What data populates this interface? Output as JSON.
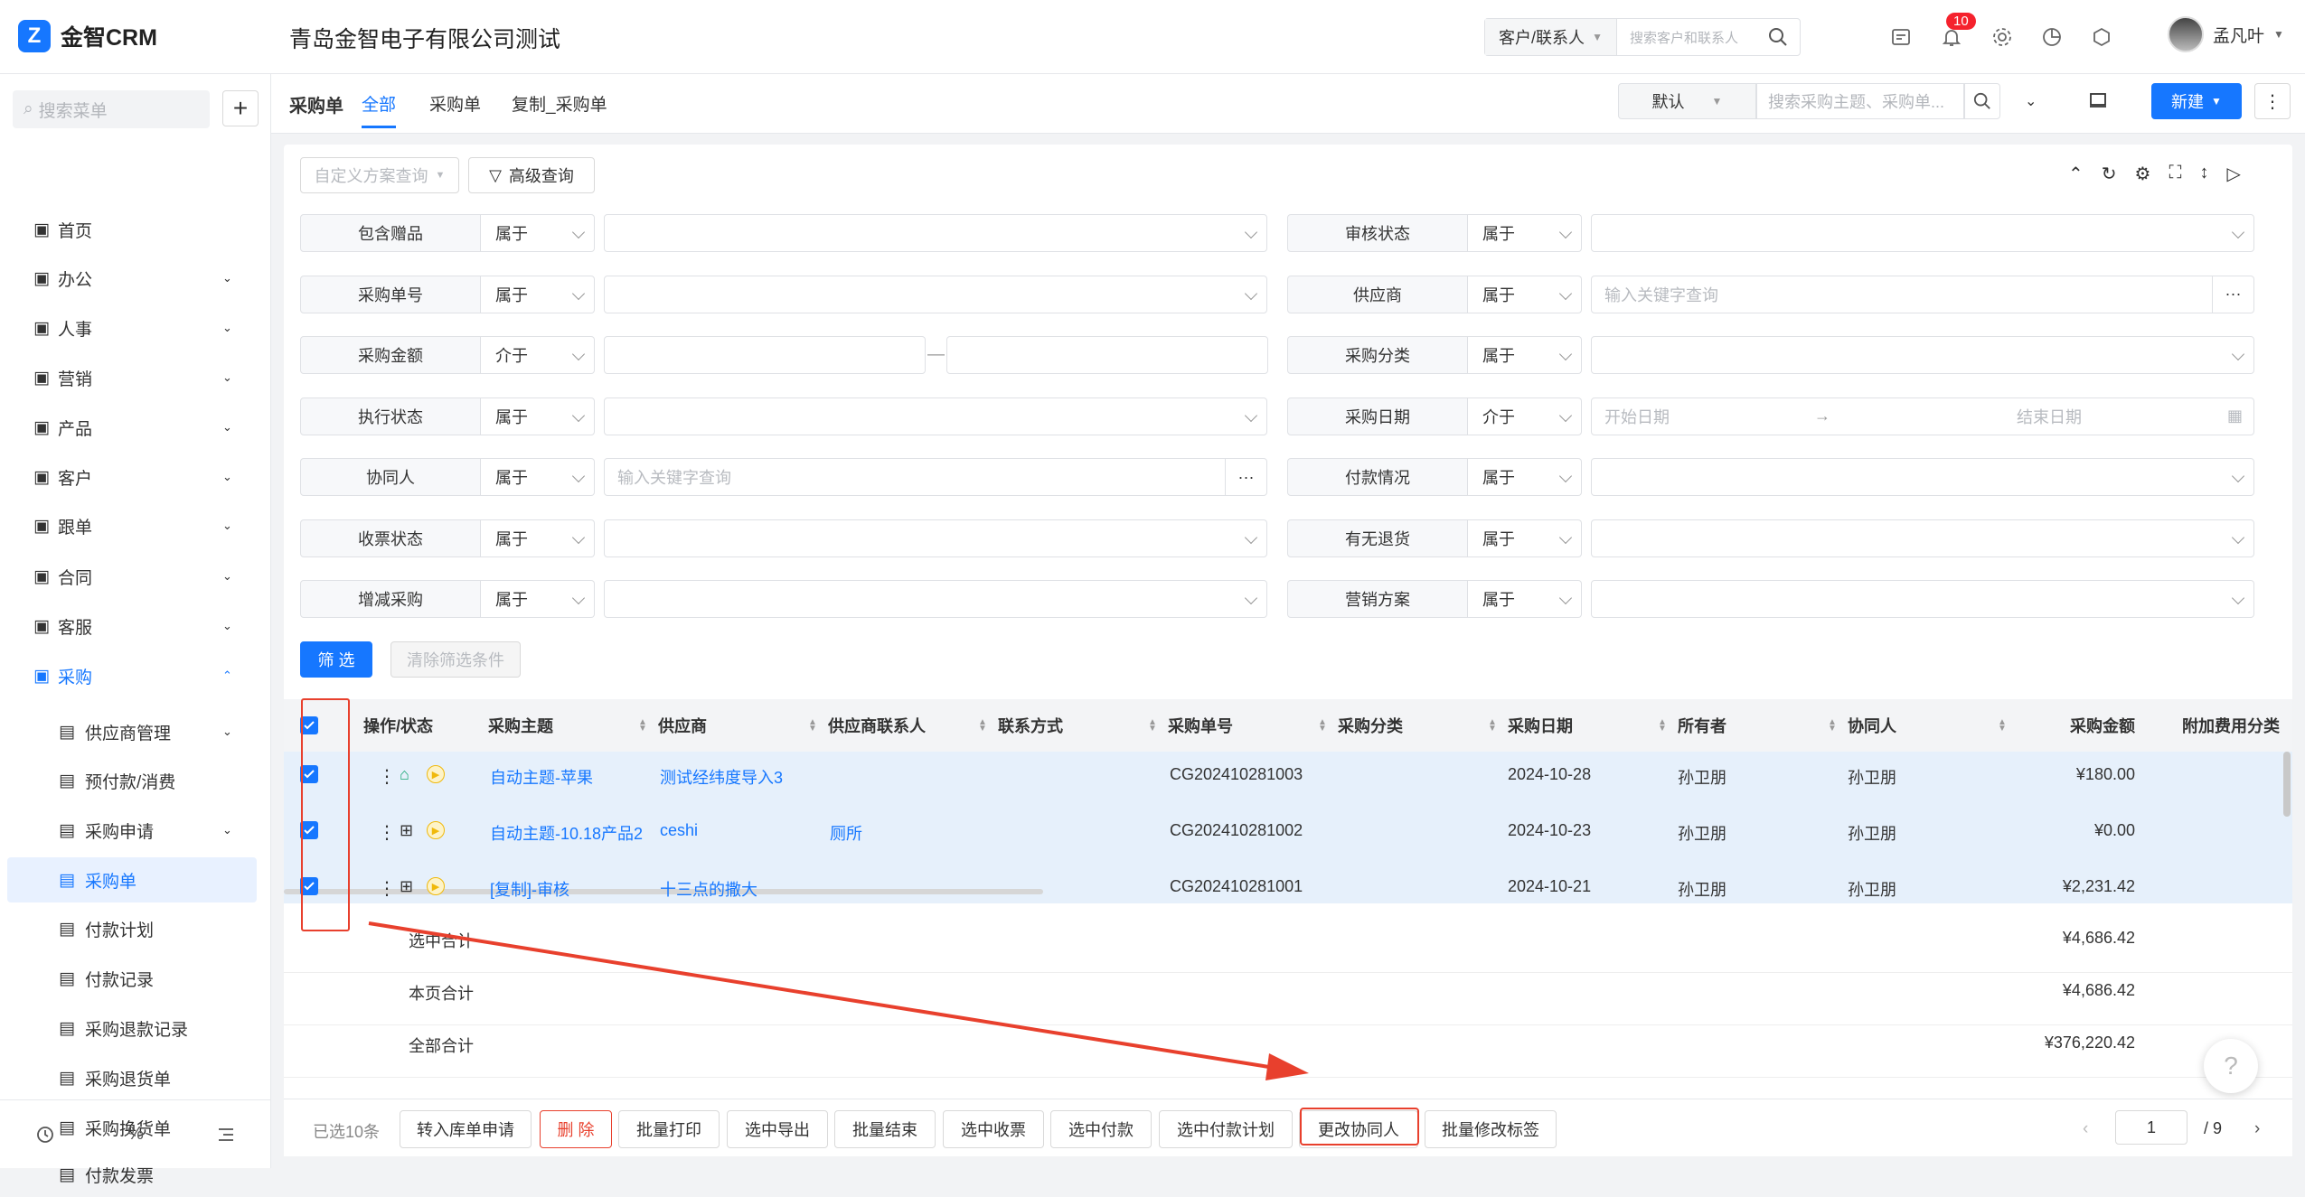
{
  "app": {
    "name": "金智CRM",
    "company": "青岛金智电子有限公司测试",
    "logo_letter": "Z"
  },
  "header": {
    "search_scope": "客户/联系人",
    "search_placeholder": "搜索客户和联系人",
    "notification_count": "10",
    "user_name": "孟凡叶"
  },
  "sidebar": {
    "search_placeholder": "搜索菜单",
    "items": [
      {
        "label": "首页",
        "icon": "grid-icon"
      },
      {
        "label": "办公",
        "icon": "printer-icon"
      },
      {
        "label": "人事",
        "icon": "people-icon"
      },
      {
        "label": "营销",
        "icon": "copy-icon"
      },
      {
        "label": "产品",
        "icon": "cube-icon"
      },
      {
        "label": "客户",
        "icon": "chart-icon"
      },
      {
        "label": "跟单",
        "icon": "target-icon"
      },
      {
        "label": "合同",
        "icon": "file-icon"
      },
      {
        "label": "客服",
        "icon": "headset-icon"
      },
      {
        "label": "采购",
        "icon": "cart-icon"
      }
    ],
    "sub_items": [
      {
        "label": "供应商管理"
      },
      {
        "label": "预付款/消费"
      },
      {
        "label": "采购申请"
      },
      {
        "label": "采购单"
      },
      {
        "label": "付款计划"
      },
      {
        "label": "付款记录"
      },
      {
        "label": "采购退款记录"
      },
      {
        "label": "采购退货单"
      },
      {
        "label": "采购换货单"
      },
      {
        "label": "付款发票"
      }
    ]
  },
  "page": {
    "title": "采购单",
    "tabs": [
      "全部",
      "采购单",
      "复制_采购单"
    ],
    "view": "默认",
    "search_placeholder": "搜索采购主题、采购单...",
    "new_label": "新建"
  },
  "filters": {
    "custom_query": "自定义方案查询",
    "advanced": "高级查询",
    "submit": "筛 选",
    "clear": "清除筛选条件",
    "rows": [
      {
        "l": {
          "label": "包含赠品",
          "op": "属于",
          "ph": ""
        },
        "r": {
          "label": "审核状态",
          "op": "属于",
          "ph": ""
        }
      },
      {
        "l": {
          "label": "采购单号",
          "op": "属于",
          "ph": ""
        },
        "r": {
          "label": "供应商",
          "op": "属于",
          "ph": "输入关键字查询"
        }
      },
      {
        "l": {
          "label": "采购金额",
          "op": "介于",
          "ph": ""
        },
        "r": {
          "label": "采购分类",
          "op": "属于",
          "ph": ""
        }
      },
      {
        "l": {
          "label": "执行状态",
          "op": "属于",
          "ph": ""
        },
        "r": {
          "label": "采购日期",
          "op": "介于",
          "ph": "开始日期",
          "ph2": "结束日期"
        }
      },
      {
        "l": {
          "label": "协同人",
          "op": "属于",
          "ph": "输入关键字查询"
        },
        "r": {
          "label": "付款情况",
          "op": "属于",
          "ph": ""
        }
      },
      {
        "l": {
          "label": "收票状态",
          "op": "属于",
          "ph": ""
        },
        "r": {
          "label": "有无退货",
          "op": "属于",
          "ph": ""
        }
      },
      {
        "l": {
          "label": "增减采购",
          "op": "属于",
          "ph": ""
        },
        "r": {
          "label": "营销方案",
          "op": "属于",
          "ph": ""
        }
      }
    ]
  },
  "table": {
    "columns": [
      "操作/状态",
      "采购主题",
      "供应商",
      "供应商联系人",
      "联系方式",
      "采购单号",
      "采购分类",
      "采购日期",
      "所有者",
      "协同人",
      "采购金额",
      "附加费用分类"
    ],
    "rows": [
      {
        "subject": "自动主题-苹果",
        "supplier": "测试经纬度导入3",
        "contact": "",
        "no": "CG202410281003",
        "date": "2024-10-28",
        "owner": "孙卫朋",
        "collab": "孙卫朋",
        "amount": "¥180.00"
      },
      {
        "subject": "自动主题-10.18产品2",
        "supplier": "ceshi",
        "contact": "厕所",
        "no": "CG202410281002",
        "date": "2024-10-23",
        "owner": "孙卫朋",
        "collab": "孙卫朋",
        "amount": "¥0.00"
      },
      {
        "subject": "[复制]-审核",
        "supplier": "十三点的撒大",
        "contact": "",
        "no": "CG202410281001",
        "date": "2024-10-21",
        "owner": "孙卫朋",
        "collab": "孙卫朋",
        "amount": "¥2,231.42"
      }
    ],
    "summary": [
      {
        "label": "选中合计",
        "value": "¥4,686.42"
      },
      {
        "label": "本页合计",
        "value": "¥4,686.42"
      },
      {
        "label": "全部合计",
        "value": "¥376,220.42"
      }
    ]
  },
  "footer": {
    "selected": "已选10条",
    "actions": [
      "转入库单申请",
      "删 除",
      "批量打印",
      "选中导出",
      "批量结束",
      "选中收票",
      "选中付款",
      "选中付款计划",
      "更改协同人",
      "批量修改标签"
    ],
    "page": "1",
    "total_pages": "/  9"
  },
  "colors": {
    "accent": "#1677ff",
    "annotation": "#e8402d"
  }
}
